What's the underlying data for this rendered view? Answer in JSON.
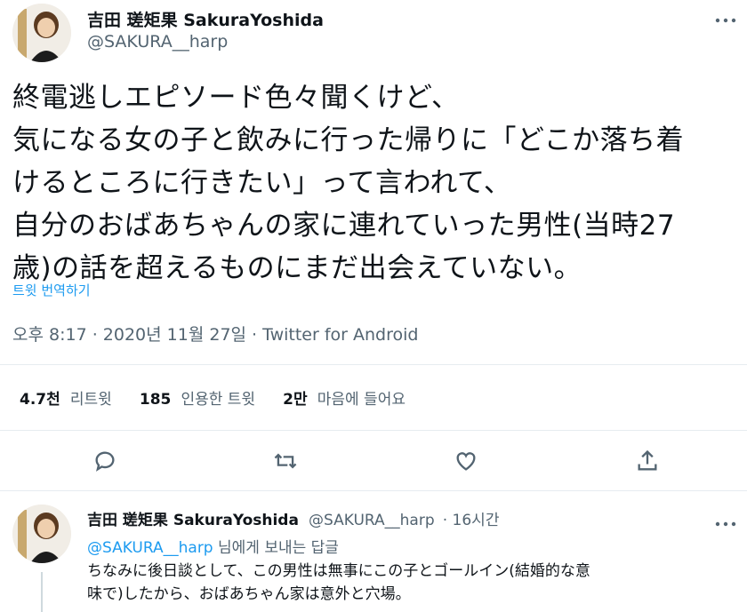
{
  "tweet": {
    "display_name": "吉田 瑳矩果 SakuraYoshida",
    "handle": "@SAKURA__harp",
    "lines": [
      "終電逃しエピソード色々聞くけど、",
      "気になる女の子と飲みに行った帰りに「どこか落ち着",
      "けるところに行きたい」って言われて、",
      "自分のおばあちゃんの家に連れていった男性(当時27",
      "歳)の話を超えるものにまだ出会えていない。"
    ],
    "translate_label": "트윗 번역하기",
    "timestamp": "오후 8:17 · 2020년 11월 27일 · Twitter for Android",
    "stats": [
      {
        "number": "4.7천",
        "label": "리트윗"
      },
      {
        "number": "185",
        "label": "인용한 트윗"
      },
      {
        "number": "2만",
        "label": "마음에 들어요"
      }
    ],
    "more_icon": "more-icon",
    "actions": [
      "reply-icon",
      "retweet-icon",
      "like-icon",
      "share-icon"
    ]
  },
  "reply": {
    "display_name": "吉田 瑳矩果 SakuraYoshida",
    "handle": "@SAKURA__harp",
    "time": "· 16시간",
    "reply_to_handle": "@SAKURA__harp",
    "reply_to_suffix": " 님에게 보내는 답글",
    "lines": [
      "ちなみに後日談として、この男性は無事にこの子とゴールイン(結婚的な意",
      "味で)したから、おばあちゃん家は意外と穴場。"
    ]
  },
  "colors": {
    "accent": "#1d9bf0",
    "secondary_text": "#536471",
    "divider": "#e6ecf0"
  }
}
